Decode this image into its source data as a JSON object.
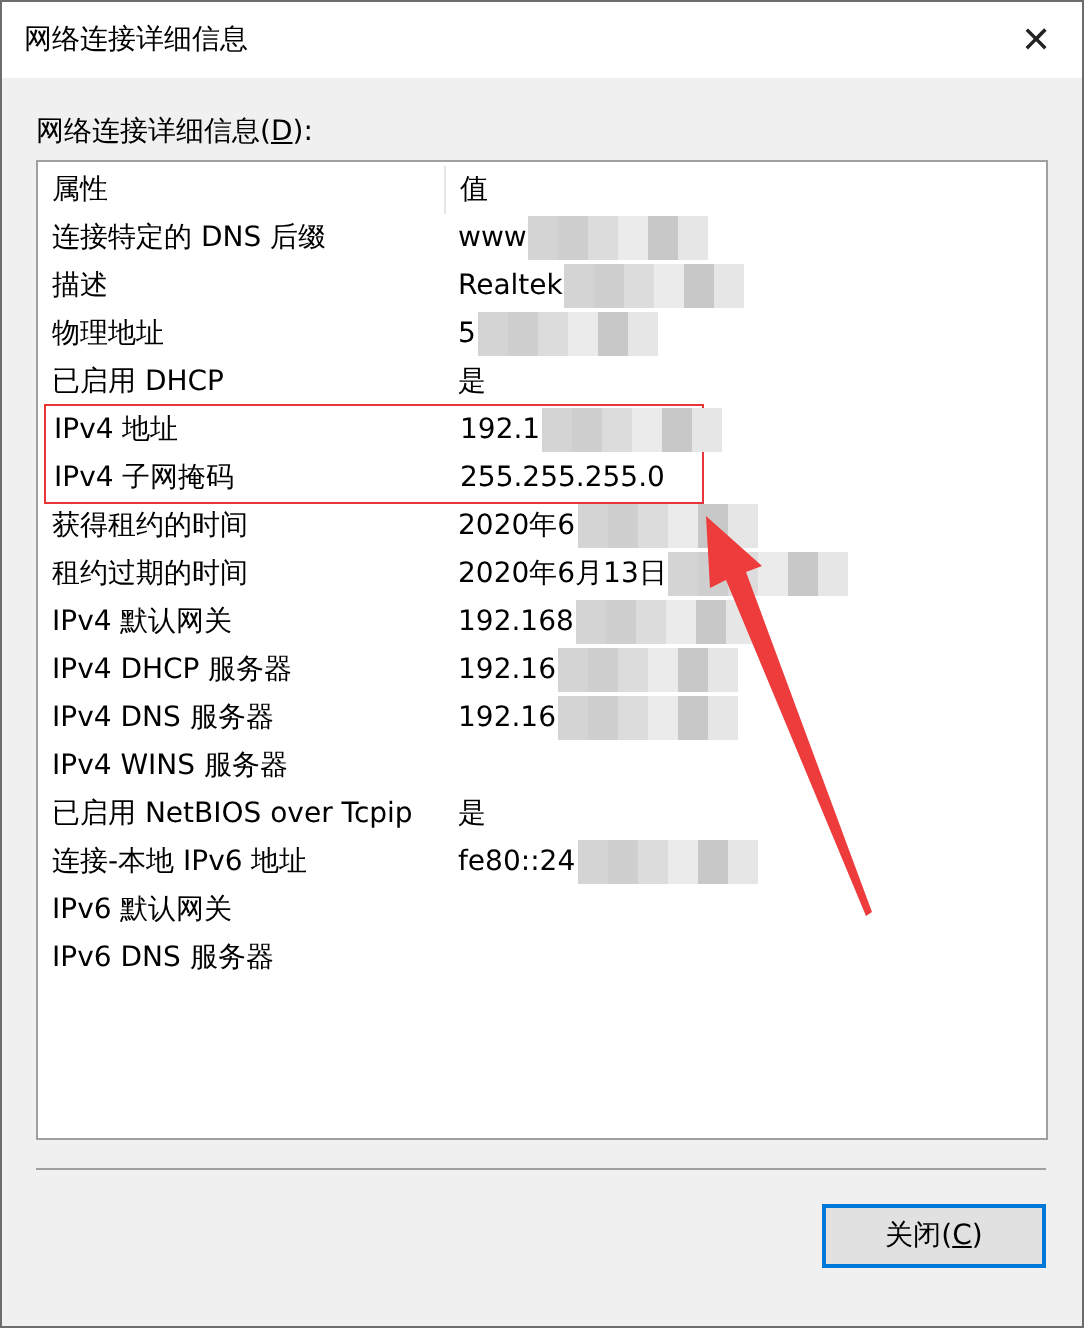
{
  "window": {
    "title": "网络连接详细信息",
    "close": "✕"
  },
  "list_label": {
    "text": "网络连接详细信息(",
    "accelerator": "D",
    "suffix": "):"
  },
  "table": {
    "columns": [
      "属性",
      "值"
    ],
    "rows": [
      {
        "property": "连接特定的 DNS 后缀",
        "value": "www",
        "redacted": true,
        "highlighted": false
      },
      {
        "property": "描述",
        "value": "Realtek",
        "redacted": true,
        "highlighted": false
      },
      {
        "property": "物理地址",
        "value": "5",
        "redacted": true,
        "highlighted": false
      },
      {
        "property": "已启用 DHCP",
        "value": "是",
        "redacted": false,
        "highlighted": false
      },
      {
        "property": "IPv4 地址",
        "value": "192.1",
        "redacted": true,
        "highlighted": true
      },
      {
        "property": "IPv4 子网掩码",
        "value": "255.255.255.0",
        "redacted": false,
        "highlighted": true
      },
      {
        "property": "获得租约的时间",
        "value": "2020年6",
        "redacted": true,
        "highlighted": false
      },
      {
        "property": "租约过期的时间",
        "value": "2020年6月13日",
        "redacted": true,
        "highlighted": false
      },
      {
        "property": "IPv4 默认网关",
        "value": "192.168",
        "redacted": true,
        "highlighted": false
      },
      {
        "property": "IPv4 DHCP 服务器",
        "value": "192.16",
        "redacted": true,
        "highlighted": false
      },
      {
        "property": "IPv4 DNS 服务器",
        "value": "192.16",
        "redacted": true,
        "highlighted": false
      },
      {
        "property": "IPv4 WINS 服务器",
        "redacted": false,
        "highlighted": false
      },
      {
        "property": "已启用 NetBIOS over Tcpip",
        "value": "是",
        "redacted": false,
        "highlighted": false
      },
      {
        "property": "连接-本地 IPv6 地址",
        "value": "fe80::24",
        "redacted": true,
        "highlighted": false
      },
      {
        "property": "IPv6 默认网关",
        "redacted": false,
        "highlighted": false
      },
      {
        "property": "IPv6 DNS 服务器",
        "redacted": false,
        "highlighted": false
      }
    ]
  },
  "close_button": {
    "text": "关闭(",
    "accelerator": "C",
    "suffix": ")"
  }
}
